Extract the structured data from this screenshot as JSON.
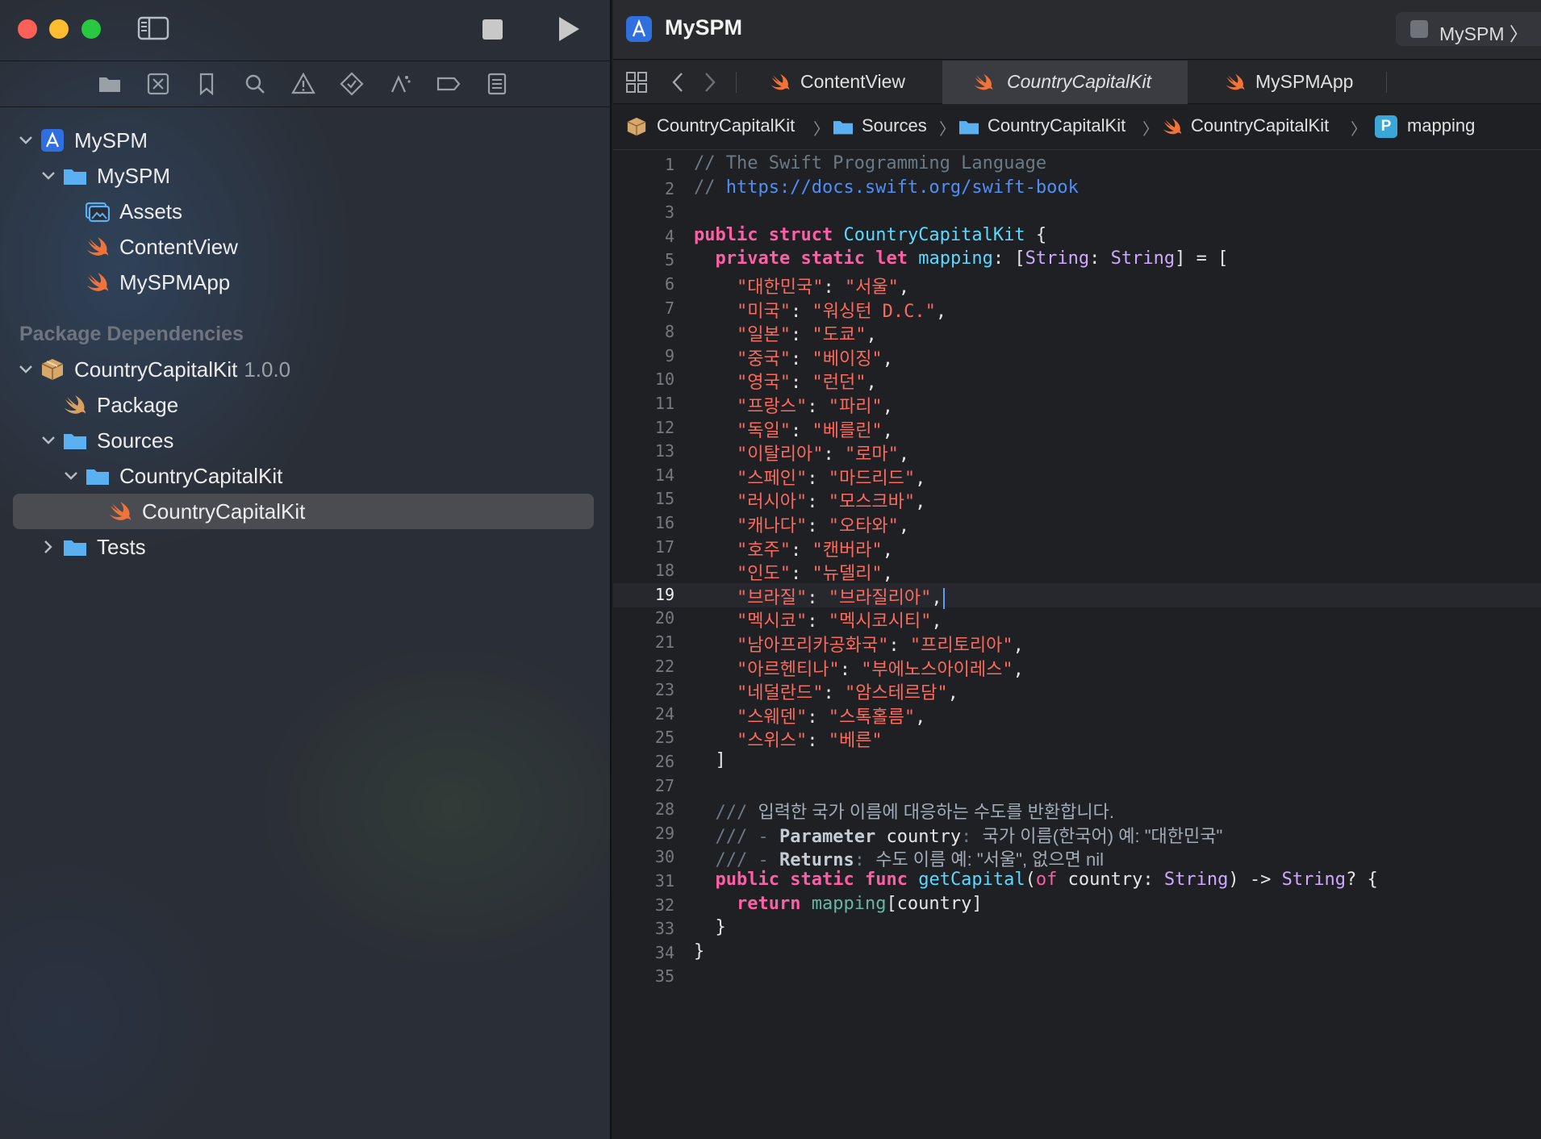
{
  "window": {
    "title": "MySPM",
    "scheme": "MySPM"
  },
  "navigator": {
    "icons": [
      "folder-icon",
      "source-control-icon",
      "bookmark-icon",
      "search-icon",
      "warning-icon",
      "test-icon",
      "debug-icon",
      "breakpoint-icon",
      "report-icon"
    ],
    "project": {
      "root": "MySPM",
      "group": "MySPM",
      "files": [
        "Assets",
        "ContentView",
        "MySPMApp"
      ]
    },
    "package_section_header": "Package Dependencies",
    "package": {
      "name": "CountryCapitalKit",
      "version": "1.0.0",
      "manifest": "Package",
      "sources_folder": "Sources",
      "target_folder": "CountryCapitalKit",
      "selected_file": "CountryCapitalKit",
      "tests_folder": "Tests"
    }
  },
  "tabs": [
    {
      "label": "ContentView",
      "active": false
    },
    {
      "label": "CountryCapitalKit",
      "active": true
    },
    {
      "label": "MySPMApp",
      "active": false
    }
  ],
  "breadcrumb": {
    "items": [
      "CountryCapitalKit",
      "Sources",
      "CountryCapitalKit",
      "CountryCapitalKit",
      "mapping"
    ],
    "badge": "P",
    "separator": "〉"
  },
  "editor": {
    "current_line": 19,
    "lines": [
      [
        [
          "cmt",
          "// The Swift Programming Language"
        ]
      ],
      [
        [
          "cmt",
          "// "
        ],
        [
          "url",
          "https://docs.swift.org/swift-book"
        ]
      ],
      [],
      [
        [
          "kw",
          "public"
        ],
        [
          "plain",
          " "
        ],
        [
          "kw",
          "struct"
        ],
        [
          "plain",
          " "
        ],
        [
          "decl",
          "CountryCapitalKit"
        ],
        [
          "plain",
          " {"
        ]
      ],
      [
        [
          "plain",
          "  "
        ],
        [
          "kw",
          "private"
        ],
        [
          "plain",
          " "
        ],
        [
          "kw",
          "static"
        ],
        [
          "plain",
          " "
        ],
        [
          "kw",
          "let"
        ],
        [
          "plain",
          " "
        ],
        [
          "decl",
          "mapping"
        ],
        [
          "plain",
          ": ["
        ],
        [
          "type",
          "String"
        ],
        [
          "plain",
          ": "
        ],
        [
          "type",
          "String"
        ],
        [
          "plain",
          "] = ["
        ]
      ],
      [
        [
          "plain",
          "    "
        ],
        [
          "str",
          "\"대한민국\""
        ],
        [
          "plain",
          ": "
        ],
        [
          "str",
          "\"서울\""
        ],
        [
          "plain",
          ","
        ]
      ],
      [
        [
          "plain",
          "    "
        ],
        [
          "str",
          "\"미국\""
        ],
        [
          "plain",
          ": "
        ],
        [
          "str",
          "\"워싱턴 D.C.\""
        ],
        [
          "plain",
          ","
        ]
      ],
      [
        [
          "plain",
          "    "
        ],
        [
          "str",
          "\"일본\""
        ],
        [
          "plain",
          ": "
        ],
        [
          "str",
          "\"도쿄\""
        ],
        [
          "plain",
          ","
        ]
      ],
      [
        [
          "plain",
          "    "
        ],
        [
          "str",
          "\"중국\""
        ],
        [
          "plain",
          ": "
        ],
        [
          "str",
          "\"베이징\""
        ],
        [
          "plain",
          ","
        ]
      ],
      [
        [
          "plain",
          "    "
        ],
        [
          "str",
          "\"영국\""
        ],
        [
          "plain",
          ": "
        ],
        [
          "str",
          "\"런던\""
        ],
        [
          "plain",
          ","
        ]
      ],
      [
        [
          "plain",
          "    "
        ],
        [
          "str",
          "\"프랑스\""
        ],
        [
          "plain",
          ": "
        ],
        [
          "str",
          "\"파리\""
        ],
        [
          "plain",
          ","
        ]
      ],
      [
        [
          "plain",
          "    "
        ],
        [
          "str",
          "\"독일\""
        ],
        [
          "plain",
          ": "
        ],
        [
          "str",
          "\"베를린\""
        ],
        [
          "plain",
          ","
        ]
      ],
      [
        [
          "plain",
          "    "
        ],
        [
          "str",
          "\"이탈리아\""
        ],
        [
          "plain",
          ": "
        ],
        [
          "str",
          "\"로마\""
        ],
        [
          "plain",
          ","
        ]
      ],
      [
        [
          "plain",
          "    "
        ],
        [
          "str",
          "\"스페인\""
        ],
        [
          "plain",
          ": "
        ],
        [
          "str",
          "\"마드리드\""
        ],
        [
          "plain",
          ","
        ]
      ],
      [
        [
          "plain",
          "    "
        ],
        [
          "str",
          "\"러시아\""
        ],
        [
          "plain",
          ": "
        ],
        [
          "str",
          "\"모스크바\""
        ],
        [
          "plain",
          ","
        ]
      ],
      [
        [
          "plain",
          "    "
        ],
        [
          "str",
          "\"캐나다\""
        ],
        [
          "plain",
          ": "
        ],
        [
          "str",
          "\"오타와\""
        ],
        [
          "plain",
          ","
        ]
      ],
      [
        [
          "plain",
          "    "
        ],
        [
          "str",
          "\"호주\""
        ],
        [
          "plain",
          ": "
        ],
        [
          "str",
          "\"캔버라\""
        ],
        [
          "plain",
          ","
        ]
      ],
      [
        [
          "plain",
          "    "
        ],
        [
          "str",
          "\"인도\""
        ],
        [
          "plain",
          ": "
        ],
        [
          "str",
          "\"뉴델리\""
        ],
        [
          "plain",
          ","
        ]
      ],
      [
        [
          "plain",
          "    "
        ],
        [
          "str",
          "\"브라질\""
        ],
        [
          "plain",
          ": "
        ],
        [
          "str",
          "\"브라질리아\""
        ],
        [
          "plain",
          ","
        ]
      ],
      [
        [
          "plain",
          "    "
        ],
        [
          "str",
          "\"멕시코\""
        ],
        [
          "plain",
          ": "
        ],
        [
          "str",
          "\"멕시코시티\""
        ],
        [
          "plain",
          ","
        ]
      ],
      [
        [
          "plain",
          "    "
        ],
        [
          "str",
          "\"남아프리카공화국\""
        ],
        [
          "plain",
          ": "
        ],
        [
          "str",
          "\"프리토리아\""
        ],
        [
          "plain",
          ","
        ]
      ],
      [
        [
          "plain",
          "    "
        ],
        [
          "str",
          "\"아르헨티나\""
        ],
        [
          "plain",
          ": "
        ],
        [
          "str",
          "\"부에노스아이레스\""
        ],
        [
          "plain",
          ","
        ]
      ],
      [
        [
          "plain",
          "    "
        ],
        [
          "str",
          "\"네덜란드\""
        ],
        [
          "plain",
          ": "
        ],
        [
          "str",
          "\"암스테르담\""
        ],
        [
          "plain",
          ","
        ]
      ],
      [
        [
          "plain",
          "    "
        ],
        [
          "str",
          "\"스웨덴\""
        ],
        [
          "plain",
          ": "
        ],
        [
          "str",
          "\"스톡홀름\""
        ],
        [
          "plain",
          ","
        ]
      ],
      [
        [
          "plain",
          "    "
        ],
        [
          "str",
          "\"스위스\""
        ],
        [
          "plain",
          ": "
        ],
        [
          "str",
          "\"베른\""
        ]
      ],
      [
        [
          "plain",
          "  ]"
        ]
      ],
      [],
      [
        [
          "plain",
          "  "
        ],
        [
          "cmt",
          "/// "
        ],
        [
          "doc",
          "입력한 국가 이름에 대응하는 수도를 반환합니다."
        ]
      ],
      [
        [
          "plain",
          "  "
        ],
        [
          "cmt",
          "/// - "
        ],
        [
          "docb",
          "Parameter"
        ],
        [
          "plain",
          " "
        ],
        [
          "docb-light",
          "country"
        ],
        [
          "cmt",
          ": "
        ],
        [
          "doc",
          "국가 이름(한국어) 예: \"대한민국\""
        ]
      ],
      [
        [
          "plain",
          "  "
        ],
        [
          "cmt",
          "/// - "
        ],
        [
          "docb",
          "Returns"
        ],
        [
          "cmt",
          ": "
        ],
        [
          "doc",
          "수도 이름 예: \"서울\", 없으면 nil"
        ]
      ],
      [
        [
          "plain",
          "  "
        ],
        [
          "kw",
          "public"
        ],
        [
          "plain",
          " "
        ],
        [
          "kw",
          "static"
        ],
        [
          "plain",
          " "
        ],
        [
          "kw",
          "func"
        ],
        [
          "plain",
          " "
        ],
        [
          "decl",
          "getCapital"
        ],
        [
          "plain",
          "("
        ],
        [
          "kw-light",
          "of"
        ],
        [
          "plain",
          " country: "
        ],
        [
          "type",
          "String"
        ],
        [
          "plain",
          ") -> "
        ],
        [
          "type",
          "String"
        ],
        [
          "plain",
          "? {"
        ]
      ],
      [
        [
          "plain",
          "    "
        ],
        [
          "kw",
          "return"
        ],
        [
          "plain",
          " "
        ],
        [
          "fn",
          "mapping"
        ],
        [
          "plain",
          "[country]"
        ]
      ],
      [
        [
          "plain",
          "  }"
        ]
      ],
      [
        [
          "plain",
          "}"
        ]
      ],
      []
    ]
  },
  "colors": {
    "keyword": "#fc5fa3",
    "string": "#fc6a5d",
    "type": "#d0a8ff",
    "declaration": "#5dd8ff",
    "comment": "#6c7986",
    "url": "#4f8ff7",
    "swift_orange": "#f0733a",
    "folder_blue": "#5ab0f0"
  }
}
